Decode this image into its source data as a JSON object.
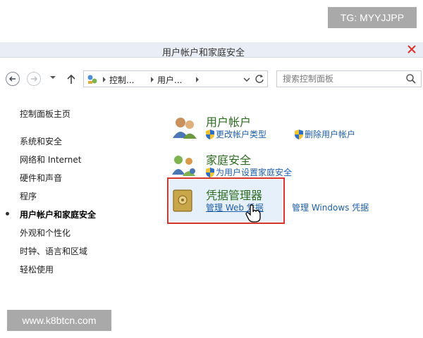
{
  "watermarks": {
    "top": "TG: MYYJJPP",
    "bottom": "www.k8btcn.com"
  },
  "window": {
    "title": "用户帐户和家庭安全"
  },
  "address_bar": {
    "crumbs": [
      "控制...",
      "用户..."
    ],
    "search_placeholder": "搜索控制面板"
  },
  "sidebar": {
    "home": "控制面板主页",
    "items": [
      {
        "label": "系统和安全",
        "active": false
      },
      {
        "label": "网络和 Internet",
        "active": false
      },
      {
        "label": "硬件和声音",
        "active": false
      },
      {
        "label": "程序",
        "active": false
      },
      {
        "label": "用户帐户和家庭安全",
        "active": true
      },
      {
        "label": "外观和个性化",
        "active": false
      },
      {
        "label": "时钟、语言和区域",
        "active": false
      },
      {
        "label": "轻松使用",
        "active": false
      }
    ]
  },
  "categories": [
    {
      "title": "用户帐户",
      "links": [
        "更改帐户类型",
        "删除用户帐户"
      ]
    },
    {
      "title": "家庭安全",
      "links": [
        "为用户设置家庭安全"
      ]
    },
    {
      "title": "凭据管理器",
      "links": [
        "管理 Web 凭据",
        "管理 Windows 凭据"
      ]
    }
  ],
  "colors": {
    "link": "#1f5ea8",
    "category_title": "#2c6b1f",
    "highlight_box": "#d9342b"
  }
}
